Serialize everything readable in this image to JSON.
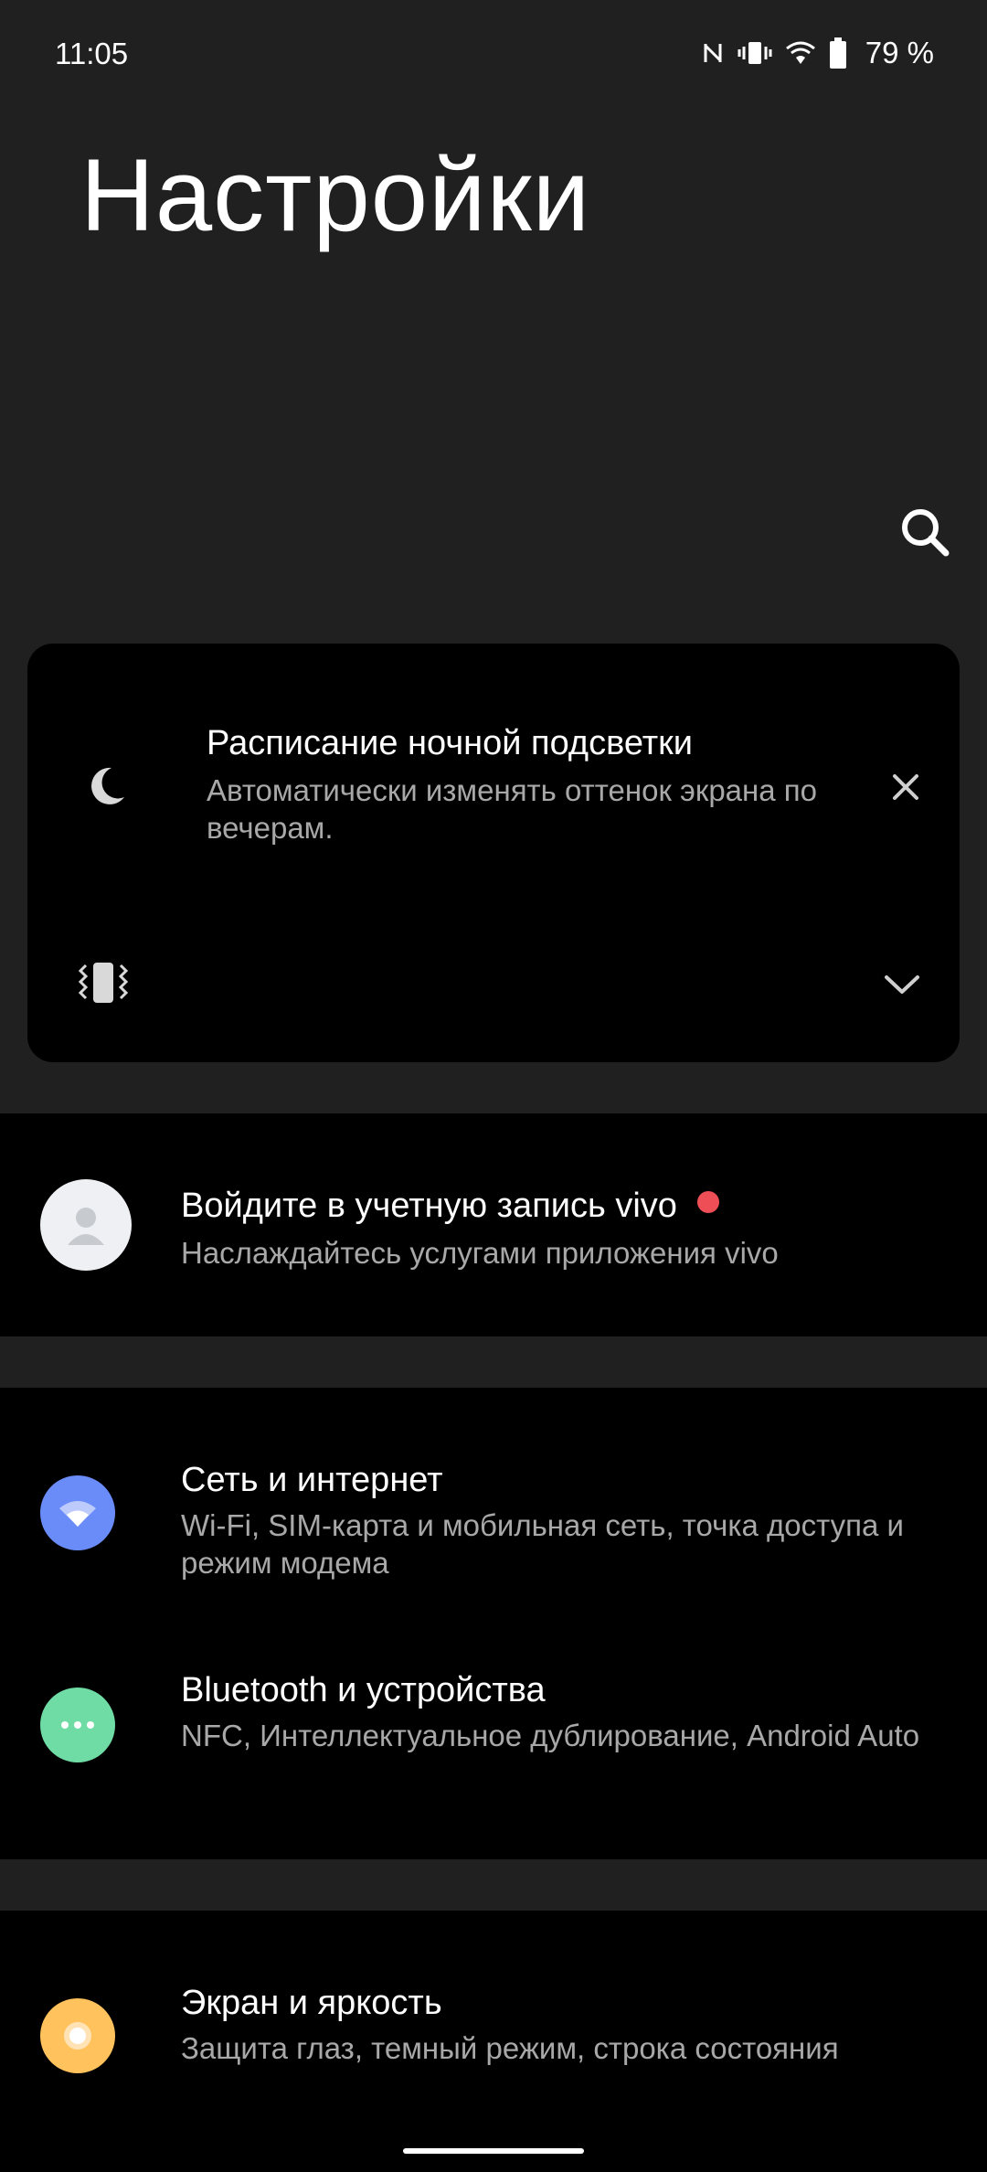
{
  "status_bar": {
    "time": "11:05",
    "battery": "79 %",
    "icons": [
      "nfc-icon",
      "vibrate-icon",
      "wifi-icon",
      "battery-icon"
    ]
  },
  "header": {
    "title": "Настройки",
    "search_icon": "search-icon"
  },
  "suggestion": {
    "title": "Расписание ночной подсветки",
    "description": "Автоматически изменять оттенок экрана по вечерам.",
    "icon": "moon-icon",
    "secondary_icon": "vibrate-icon"
  },
  "account": {
    "title": "Войдите в учетную запись vivo",
    "subtitle": "Наслаждайтесь услугами приложения vivo",
    "dot_color": "#ee4e55"
  },
  "items": [
    {
      "title": "Сеть и интернет",
      "subtitle": "Wi-Fi, SIM-карта и мобильная сеть, точка доступа и режим модема",
      "icon": "wifi-icon",
      "color": "#6a8cf8"
    },
    {
      "title": "Bluetooth и устройства",
      "subtitle": "NFC, Интеллектуальное дублирование, Android Auto",
      "icon": "more-dots-icon",
      "color": "#6fdca6"
    },
    {
      "title": "Экран и яркость",
      "subtitle": "Защита глаз, темный режим, строка состояния",
      "icon": "brightness-icon",
      "color": "#ffc25c"
    }
  ],
  "colors": {
    "background": "#202020",
    "card": "#000000",
    "secondary_text": "#a8a8a8"
  }
}
